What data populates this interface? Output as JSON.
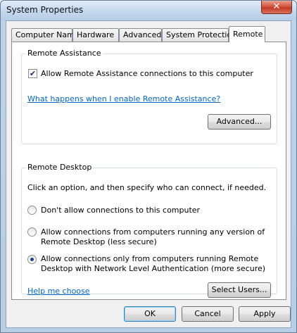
{
  "window": {
    "title": "System Properties",
    "close_glyph": "✕"
  },
  "tabs": [
    {
      "label": "Computer Name"
    },
    {
      "label": "Hardware"
    },
    {
      "label": "Advanced"
    },
    {
      "label": "System Protection"
    },
    {
      "label": "Remote",
      "active": true
    }
  ],
  "remote_assistance": {
    "legend": "Remote Assistance",
    "allow_checkbox_label": "Allow Remote Assistance connections to this computer",
    "allow_checked": true,
    "help_link": "What happens when I enable Remote Assistance?",
    "advanced_button": "Advanced..."
  },
  "remote_desktop": {
    "legend": "Remote Desktop",
    "instruction": "Click an option, and then specify who can connect, if needed.",
    "options": [
      {
        "line1": "Don't allow connections to this computer",
        "line2": "",
        "checked": false
      },
      {
        "line1": "Allow connections from computers running any version of",
        "line2": "Remote Desktop (less secure)",
        "checked": false
      },
      {
        "line1": "Allow connections only from computers running Remote",
        "line2": "Desktop with Network Level Authentication (more secure)",
        "checked": true
      }
    ],
    "help_link": "Help me choose",
    "select_users_button": "Select Users..."
  },
  "footer": {
    "ok": "OK",
    "cancel": "Cancel",
    "apply": "Apply"
  },
  "icons": {
    "checkmark": "✔"
  }
}
